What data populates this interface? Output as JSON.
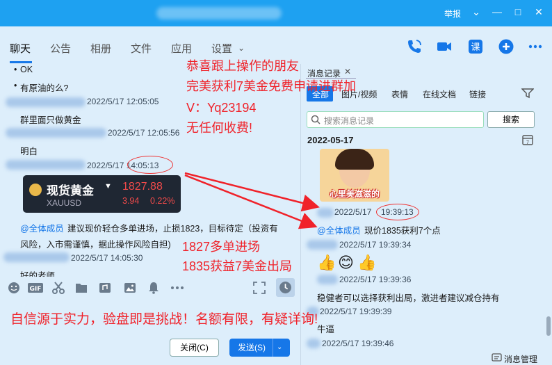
{
  "titlebar": {
    "report": "举报"
  },
  "tabs": [
    "聊天",
    "公告",
    "相册",
    "文件",
    "应用",
    "设置"
  ],
  "left": {
    "m1": "OK",
    "m2": "有原油的么?",
    "ts1": "2022/5/17 12:05:05",
    "m3": "群里面只做黄金",
    "ts2": "2022/5/17 12:05:56",
    "m4": "明白",
    "ts3": "2022/5/17 14:05:13",
    "gold": {
      "title": "现货黄金",
      "code": "XAUUSD",
      "price": "1827.88",
      "change": "3.94",
      "pct": "0.22%"
    },
    "mention": "@全体成员",
    "m5": "建议现价轻仓多单进场，止损1823，目标待定（投资有",
    "m6": "风险，入市需谨慎，据此操作风险自担)",
    "ts4": "2022/5/17 14:05:30",
    "m7": "好的老师",
    "close": "关闭(C)",
    "send": "发送(S)"
  },
  "overlay": {
    "promo1": "恭喜跟上操作的朋友",
    "promo2": "完美获利7美金免费申请进群加",
    "promo3": "V：Yq23194",
    "promo4": "无任何收费!",
    "entry": "1827多单进场",
    "exit": "1835获益7美金出局",
    "slogan": "自信源于实力，验盘即是挑战！名额有限，有疑详询!"
  },
  "right": {
    "panel_title": "消息记录",
    "filters": [
      "全部",
      "图片/视频",
      "表情",
      "在线文档",
      "链接"
    ],
    "search_placeholder": "搜索消息记录",
    "search_btn": "搜索",
    "date": "2022-05-17",
    "sticker_text": "心里美滋滋的",
    "ts1": "2022/5/17",
    "ts1b": "19:39:13",
    "mention": "@全体成员",
    "m1": "现价1835获利7个点",
    "ts2": "2022/5/17 19:39:34",
    "ts3": "2022/5/17 19:39:36",
    "m2": "稳健者可以选择获利出局，激进者建议减仓持有",
    "ts4": "2022/5/17 19:39:39",
    "m3": "牛逼",
    "ts5": "2022/5/17 19:39:46",
    "msgmgr": "消息管理"
  }
}
